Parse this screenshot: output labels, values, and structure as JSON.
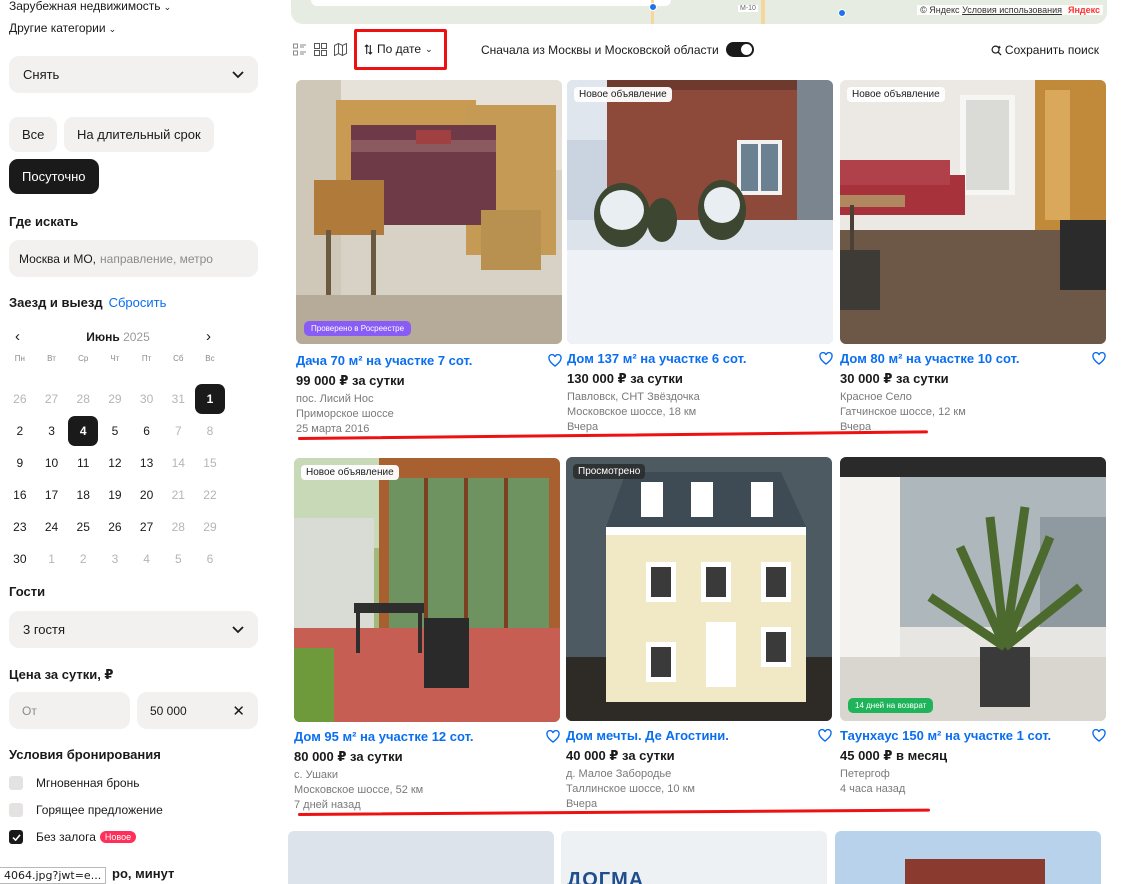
{
  "sidebar": {
    "foreign": "Зарубежная недвижимость",
    "other": "Другие категории",
    "deal_type": "Снять",
    "rent_terms": [
      "Все",
      "На длительный срок",
      "Посуточно"
    ],
    "where_title": "Где искать",
    "location_value": "Москва и МО,",
    "location_placeholder": "направление, метро",
    "checkin_title": "Заезд и выезд",
    "reset_label": "Сбросить",
    "calendar": {
      "month": "Июнь",
      "year": "2025",
      "weekdays": [
        "Пн",
        "Вт",
        "Ср",
        "Чт",
        "Пт",
        "Сб",
        "Вс"
      ],
      "days": [
        {
          "n": "26",
          "muted": true
        },
        {
          "n": "27",
          "muted": true
        },
        {
          "n": "28",
          "muted": true
        },
        {
          "n": "29",
          "muted": true
        },
        {
          "n": "30",
          "muted": true
        },
        {
          "n": "31",
          "muted": true
        },
        {
          "n": "1",
          "selected": true
        },
        {
          "n": "2"
        },
        {
          "n": "3"
        },
        {
          "n": "4",
          "selected": true
        },
        {
          "n": "5"
        },
        {
          "n": "6"
        },
        {
          "n": "7",
          "muted": true
        },
        {
          "n": "8",
          "muted": true
        },
        {
          "n": "9"
        },
        {
          "n": "10"
        },
        {
          "n": "11"
        },
        {
          "n": "12"
        },
        {
          "n": "13"
        },
        {
          "n": "14",
          "muted": true
        },
        {
          "n": "15",
          "muted": true
        },
        {
          "n": "16"
        },
        {
          "n": "17"
        },
        {
          "n": "18"
        },
        {
          "n": "19"
        },
        {
          "n": "20"
        },
        {
          "n": "21",
          "muted": true
        },
        {
          "n": "22",
          "muted": true
        },
        {
          "n": "23"
        },
        {
          "n": "24"
        },
        {
          "n": "25"
        },
        {
          "n": "26"
        },
        {
          "n": "27"
        },
        {
          "n": "28",
          "muted": true
        },
        {
          "n": "29",
          "muted": true
        },
        {
          "n": "30"
        },
        {
          "n": "1",
          "muted": true
        },
        {
          "n": "2",
          "muted": true
        },
        {
          "n": "3",
          "muted": true
        },
        {
          "n": "4",
          "muted": true
        },
        {
          "n": "5",
          "muted": true
        },
        {
          "n": "6",
          "muted": true
        }
      ]
    },
    "guests_title": "Гости",
    "guests_value": "3 гостя",
    "price_title": "Цена за сутки, ₽",
    "price_from_placeholder": "От",
    "price_to_value": "50 000",
    "booking_title": "Условия бронирования",
    "conditions": [
      {
        "label": "Мгновенная бронь",
        "checked": false
      },
      {
        "label": "Горящее предложение",
        "checked": false
      },
      {
        "label": "Без залога",
        "checked": true,
        "badge": "Новое"
      }
    ],
    "cut_off_title": "ро, минут",
    "url_tooltip": "4064.jpg?jwt=e..."
  },
  "map": {
    "credit": "© Яндекс",
    "terms": "Условия использования",
    "brand": "Яндекс",
    "road_tag": "M-10"
  },
  "toolbar": {
    "sort_label": "По дате",
    "moscow_first": "Сначала из Москвы и Московской области",
    "moscow_first_on": true,
    "save_search": "Сохранить поиск"
  },
  "listings": [
    {
      "title": "Дача 70 м² на участке 7 сот.",
      "price": "99 000 ₽ за сутки",
      "meta": [
        "пос. Лисий Нос",
        "Приморское шоссе",
        "25 марта 2016"
      ],
      "badge": "",
      "bottom_badge": "Проверено в Росреестре"
    },
    {
      "title": "Дом 137 м² на участке 6 сот.",
      "price": "130 000 ₽ за сутки",
      "meta": [
        "Павловск, СНТ Звёздочка",
        "Московское шоссе, 18 км",
        "Вчера"
      ],
      "badge": "Новое объявление",
      "bottom_badge": ""
    },
    {
      "title": "Дом 80 м² на участке 10 сот.",
      "price": "30 000 ₽ за сутки",
      "meta": [
        "Красное Село",
        "Гатчинское шоссе, 12 км",
        "Вчера"
      ],
      "badge": "Новое объявление",
      "bottom_badge": ""
    },
    {
      "title": "Дом 95 м² на участке 12 сот.",
      "price": "80 000 ₽ за сутки",
      "meta": [
        "с. Ушаки",
        "Московское шоссе, 52 км",
        "7 дней назад"
      ],
      "badge": "Новое объявление",
      "bottom_badge": ""
    },
    {
      "title": "Дом мечты. Де Агостини.",
      "price": "40 000 ₽ за сутки",
      "meta": [
        "д. Малое Забородье",
        "Таллинское шоссе, 10 км",
        "Вчера"
      ],
      "badge": "Просмотрено",
      "bottom_badge": ""
    },
    {
      "title": "Таунхаус 150 м² на участке 1 сот.",
      "price": "45 000 ₽ в месяц",
      "meta": [
        "Петергоф",
        "4 часа назад"
      ],
      "badge": "",
      "bottom_badge": "14 дней на возврат"
    }
  ],
  "next_row_partial_text": "ДОГМА",
  "colors": {
    "accent_link": "#0a6ef0",
    "annotation_red": "#ee1111",
    "badge_pink": "#ff2e5a",
    "verified_purple": "#8a5cf6",
    "return_green": "#1fb35a"
  }
}
